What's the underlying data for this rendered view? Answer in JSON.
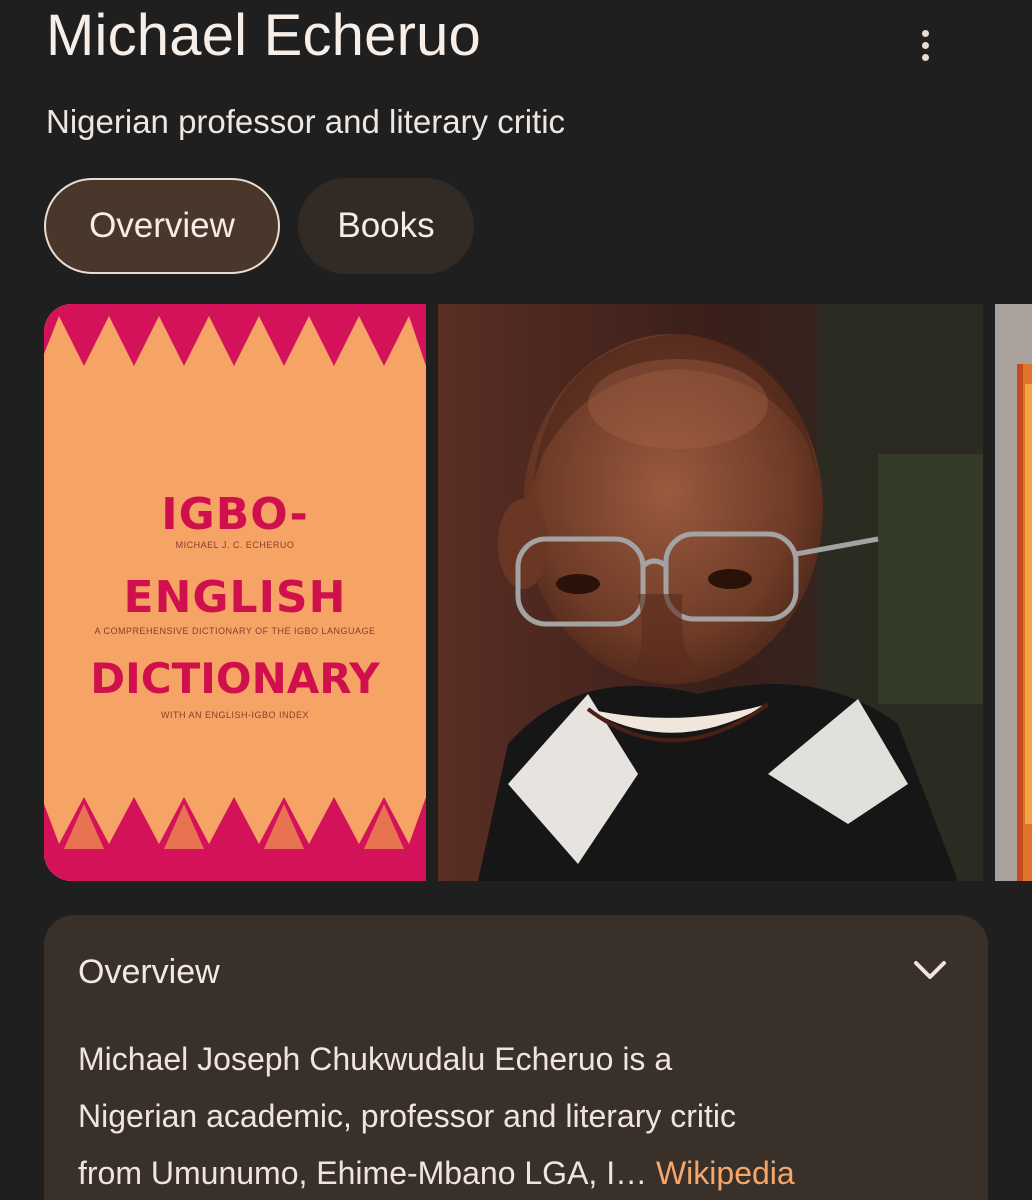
{
  "header": {
    "title": "Michael Echeruo",
    "subtitle": "Nigerian professor and literary critic",
    "more_icon": "more-vert-icon"
  },
  "tabs": [
    {
      "label": "Overview",
      "selected": true
    },
    {
      "label": "Books",
      "selected": false
    }
  ],
  "gallery": {
    "book_cover": {
      "line1": "IGBO-",
      "author": "MICHAEL J. C. ECHERUO",
      "line2": "ENGLISH",
      "tagline": "A COMPREHENSIVE DICTIONARY OF THE IGBO LANGUAGE",
      "line3": "DICTIONARY",
      "index_note": "WITH AN ENGLISH-IGBO INDEX"
    }
  },
  "overview_card": {
    "heading": "Overview",
    "chevron_icon": "chevron-down-icon",
    "text_line1": "Michael Joseph Chukwudalu Echeruo is a",
    "text_line2": "Nigerian academic, professor and literary critic",
    "text_line3": "from Umunumo, Ehime-Mbano LGA, I…",
    "source_link": "Wikipedia"
  },
  "colors": {
    "background": "#1f1f1f",
    "selected_tab": "#4a372b",
    "card": "#3a302a",
    "link": "#f5a76a",
    "book_cover": "#f5a466",
    "cover_accent": "#d0104c"
  }
}
